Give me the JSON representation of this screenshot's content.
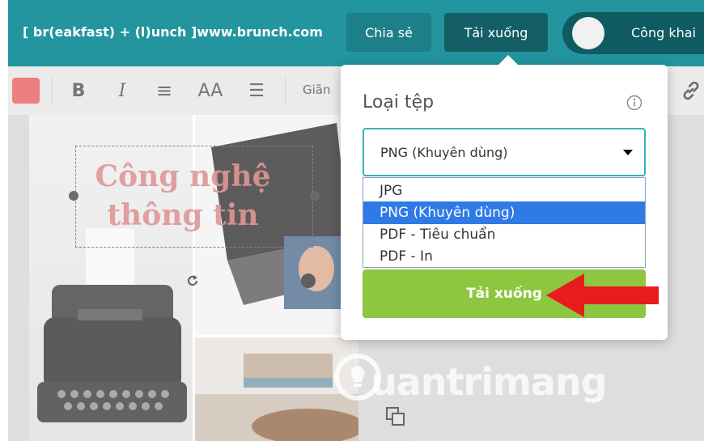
{
  "header": {
    "file_title": "[ br(eakfast) + (l)unch ]www.brunch.com",
    "share_label": "Chia sẻ",
    "download_label": "Tải xuống",
    "public_label": "Công khai"
  },
  "toolbar": {
    "text_color": "#e84b4b",
    "bold_icon": "B",
    "italic_icon": "I",
    "align_icon": "≡",
    "case_icon": "AA",
    "list_icon": "☰",
    "spacing_label": "Giãn"
  },
  "canvas": {
    "headline_line1": "Công nghệ",
    "headline_line2": "thông tin"
  },
  "download_panel": {
    "title": "Loại tệp",
    "selected_value": "PNG (Khuyên dùng)",
    "options": [
      "JPG",
      "PNG (Khuyên dùng)",
      "PDF - Tiêu chuẩn",
      "PDF - In"
    ],
    "download_button": "Tải xuống"
  },
  "watermark": {
    "text": "uantrimang"
  },
  "colors": {
    "topbar": "#22959f",
    "accent_green": "#8dc63f",
    "selection_blue": "#2f7ae5",
    "arrow_red": "#e81c1c"
  }
}
